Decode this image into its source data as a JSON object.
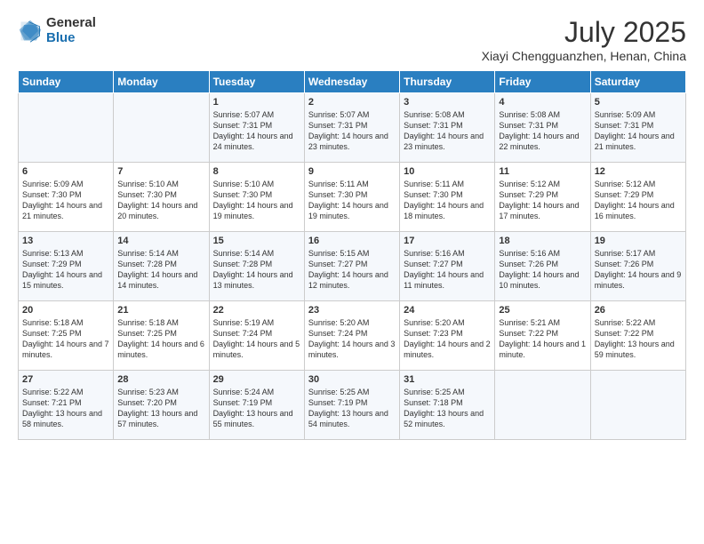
{
  "logo": {
    "general": "General",
    "blue": "Blue"
  },
  "title": {
    "month_year": "July 2025",
    "location": "Xiayi Chengguanzhen, Henan, China"
  },
  "days_of_week": [
    "Sunday",
    "Monday",
    "Tuesday",
    "Wednesday",
    "Thursday",
    "Friday",
    "Saturday"
  ],
  "weeks": [
    [
      {
        "day": "",
        "content": ""
      },
      {
        "day": "",
        "content": ""
      },
      {
        "day": "1",
        "content": "Sunrise: 5:07 AM\nSunset: 7:31 PM\nDaylight: 14 hours\nand 24 minutes."
      },
      {
        "day": "2",
        "content": "Sunrise: 5:07 AM\nSunset: 7:31 PM\nDaylight: 14 hours\nand 23 minutes."
      },
      {
        "day": "3",
        "content": "Sunrise: 5:08 AM\nSunset: 7:31 PM\nDaylight: 14 hours\nand 23 minutes."
      },
      {
        "day": "4",
        "content": "Sunrise: 5:08 AM\nSunset: 7:31 PM\nDaylight: 14 hours\nand 22 minutes."
      },
      {
        "day": "5",
        "content": "Sunrise: 5:09 AM\nSunset: 7:31 PM\nDaylight: 14 hours\nand 21 minutes."
      }
    ],
    [
      {
        "day": "6",
        "content": "Sunrise: 5:09 AM\nSunset: 7:30 PM\nDaylight: 14 hours\nand 21 minutes."
      },
      {
        "day": "7",
        "content": "Sunrise: 5:10 AM\nSunset: 7:30 PM\nDaylight: 14 hours\nand 20 minutes."
      },
      {
        "day": "8",
        "content": "Sunrise: 5:10 AM\nSunset: 7:30 PM\nDaylight: 14 hours\nand 19 minutes."
      },
      {
        "day": "9",
        "content": "Sunrise: 5:11 AM\nSunset: 7:30 PM\nDaylight: 14 hours\nand 19 minutes."
      },
      {
        "day": "10",
        "content": "Sunrise: 5:11 AM\nSunset: 7:30 PM\nDaylight: 14 hours\nand 18 minutes."
      },
      {
        "day": "11",
        "content": "Sunrise: 5:12 AM\nSunset: 7:29 PM\nDaylight: 14 hours\nand 17 minutes."
      },
      {
        "day": "12",
        "content": "Sunrise: 5:12 AM\nSunset: 7:29 PM\nDaylight: 14 hours\nand 16 minutes."
      }
    ],
    [
      {
        "day": "13",
        "content": "Sunrise: 5:13 AM\nSunset: 7:29 PM\nDaylight: 14 hours\nand 15 minutes."
      },
      {
        "day": "14",
        "content": "Sunrise: 5:14 AM\nSunset: 7:28 PM\nDaylight: 14 hours\nand 14 minutes."
      },
      {
        "day": "15",
        "content": "Sunrise: 5:14 AM\nSunset: 7:28 PM\nDaylight: 14 hours\nand 13 minutes."
      },
      {
        "day": "16",
        "content": "Sunrise: 5:15 AM\nSunset: 7:27 PM\nDaylight: 14 hours\nand 12 minutes."
      },
      {
        "day": "17",
        "content": "Sunrise: 5:16 AM\nSunset: 7:27 PM\nDaylight: 14 hours\nand 11 minutes."
      },
      {
        "day": "18",
        "content": "Sunrise: 5:16 AM\nSunset: 7:26 PM\nDaylight: 14 hours\nand 10 minutes."
      },
      {
        "day": "19",
        "content": "Sunrise: 5:17 AM\nSunset: 7:26 PM\nDaylight: 14 hours\nand 9 minutes."
      }
    ],
    [
      {
        "day": "20",
        "content": "Sunrise: 5:18 AM\nSunset: 7:25 PM\nDaylight: 14 hours\nand 7 minutes."
      },
      {
        "day": "21",
        "content": "Sunrise: 5:18 AM\nSunset: 7:25 PM\nDaylight: 14 hours\nand 6 minutes."
      },
      {
        "day": "22",
        "content": "Sunrise: 5:19 AM\nSunset: 7:24 PM\nDaylight: 14 hours\nand 5 minutes."
      },
      {
        "day": "23",
        "content": "Sunrise: 5:20 AM\nSunset: 7:24 PM\nDaylight: 14 hours\nand 3 minutes."
      },
      {
        "day": "24",
        "content": "Sunrise: 5:20 AM\nSunset: 7:23 PM\nDaylight: 14 hours\nand 2 minutes."
      },
      {
        "day": "25",
        "content": "Sunrise: 5:21 AM\nSunset: 7:22 PM\nDaylight: 14 hours\nand 1 minute."
      },
      {
        "day": "26",
        "content": "Sunrise: 5:22 AM\nSunset: 7:22 PM\nDaylight: 13 hours\nand 59 minutes."
      }
    ],
    [
      {
        "day": "27",
        "content": "Sunrise: 5:22 AM\nSunset: 7:21 PM\nDaylight: 13 hours\nand 58 minutes."
      },
      {
        "day": "28",
        "content": "Sunrise: 5:23 AM\nSunset: 7:20 PM\nDaylight: 13 hours\nand 57 minutes."
      },
      {
        "day": "29",
        "content": "Sunrise: 5:24 AM\nSunset: 7:19 PM\nDaylight: 13 hours\nand 55 minutes."
      },
      {
        "day": "30",
        "content": "Sunrise: 5:25 AM\nSunset: 7:19 PM\nDaylight: 13 hours\nand 54 minutes."
      },
      {
        "day": "31",
        "content": "Sunrise: 5:25 AM\nSunset: 7:18 PM\nDaylight: 13 hours\nand 52 minutes."
      },
      {
        "day": "",
        "content": ""
      },
      {
        "day": "",
        "content": ""
      }
    ]
  ]
}
